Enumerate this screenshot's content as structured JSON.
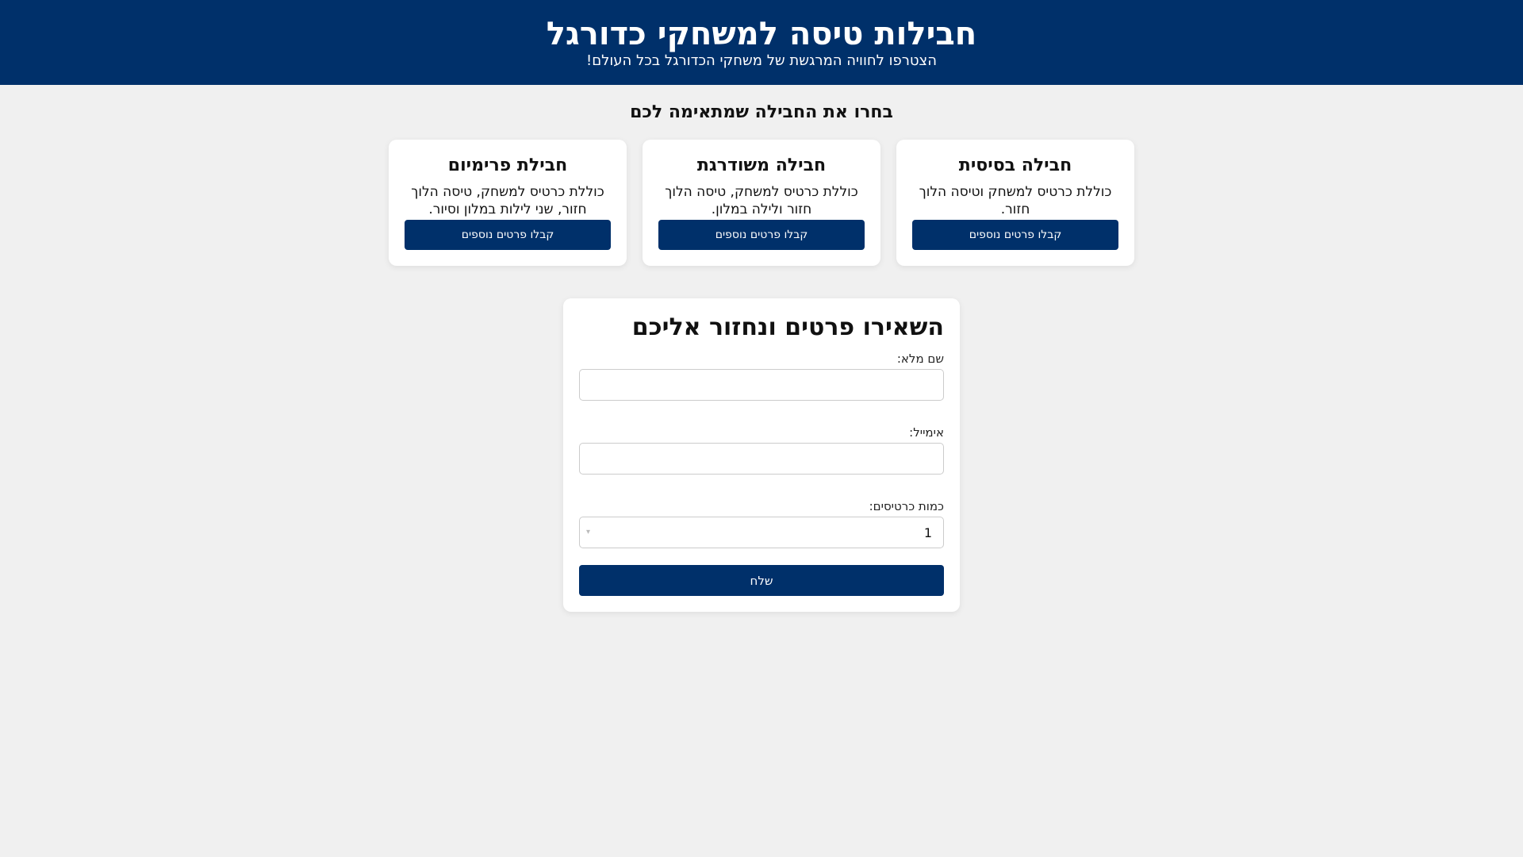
{
  "header": {
    "title": "חבילות טיסה למשחקי כדורגל",
    "subtitle": "הצטרפו לחוויה המרגשת של משחקי הכדורגל בכל העולם!"
  },
  "packages": {
    "section_title": "בחרו את החבילה שמתאימה לכם",
    "items": [
      {
        "title": "חבילה בסיסית",
        "description": "כוללת כרטיס למשחק וטיסה הלוך חזור.",
        "button": "קבלו פרטים נוספים"
      },
      {
        "title": "חבילה משודרגת",
        "description": "כוללת כרטיס למשחק, טיסה הלוך חזור ולילה במלון.",
        "button": "קבלו פרטים נוספים"
      },
      {
        "title": "חבילת פרימיום",
        "description": "כוללת כרטיס למשחק, טיסה הלוך חזור, שני לילות במלון וסיור.",
        "button": "קבלו פרטים נוספים"
      }
    ]
  },
  "form": {
    "title": "השאירו פרטים ונחזור אליכם",
    "name_label": "שם מלא:",
    "name_value": "",
    "email_label": "אימייל:",
    "email_value": "",
    "tickets_label": "כמות כרטיסים:",
    "tickets_value": "1",
    "submit_label": "שלח"
  },
  "colors": {
    "primary": "#00306a",
    "background": "#f0f0f0",
    "card": "#ffffff"
  }
}
